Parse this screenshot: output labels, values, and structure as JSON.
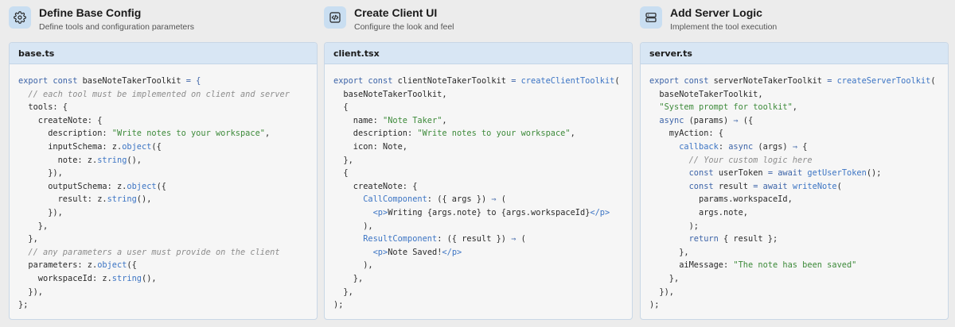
{
  "columns": [
    {
      "title": "Define Base Config",
      "subtitle": "Define tools and configuration parameters",
      "icon": "gear-icon",
      "file_name": "base.ts",
      "code": [
        [
          [
            "kw",
            "export const "
          ],
          [
            "plain",
            "baseNoteTakerToolkit "
          ],
          [
            "kw",
            "= {"
          ]
        ],
        [
          [
            "cmt",
            "  // each tool must be implemented on client and server"
          ]
        ],
        [
          [
            "plain",
            "  tools: {"
          ]
        ],
        [
          [
            "plain",
            "    createNote: {"
          ]
        ],
        [
          [
            "plain",
            "      description: "
          ],
          [
            "str",
            "\"Write notes to your workspace\""
          ],
          [
            "plain",
            ","
          ]
        ],
        [
          [
            "plain",
            "      inputSchema: z."
          ],
          [
            "fn",
            "object"
          ],
          [
            "plain",
            "({"
          ]
        ],
        [
          [
            "plain",
            "        note: z."
          ],
          [
            "fn",
            "string"
          ],
          [
            "plain",
            "(),"
          ]
        ],
        [
          [
            "plain",
            "      }),"
          ]
        ],
        [
          [
            "plain",
            "      outputSchema: z."
          ],
          [
            "fn",
            "object"
          ],
          [
            "plain",
            "({"
          ]
        ],
        [
          [
            "plain",
            "        result: z."
          ],
          [
            "fn",
            "string"
          ],
          [
            "plain",
            "(),"
          ]
        ],
        [
          [
            "plain",
            "      }),"
          ]
        ],
        [
          [
            "plain",
            "    },"
          ]
        ],
        [
          [
            "plain",
            "  },"
          ]
        ],
        [
          [
            "cmt",
            "  // any parameters a user must provide on the client"
          ]
        ],
        [
          [
            "plain",
            "  parameters: z."
          ],
          [
            "fn",
            "object"
          ],
          [
            "plain",
            "({"
          ]
        ],
        [
          [
            "plain",
            "    workspaceId: z."
          ],
          [
            "fn",
            "string"
          ],
          [
            "plain",
            "(),"
          ]
        ],
        [
          [
            "plain",
            "  }),"
          ]
        ],
        [
          [
            "plain",
            "};"
          ]
        ]
      ]
    },
    {
      "title": "Create Client UI",
      "subtitle": "Configure the look and feel",
      "icon": "code-icon",
      "file_name": "client.tsx",
      "code": [
        [
          [
            "kw",
            "export const "
          ],
          [
            "plain",
            "clientNoteTakerToolkit "
          ],
          [
            "kw",
            "= "
          ],
          [
            "fn",
            "createClientToolkit"
          ],
          [
            "plain",
            "("
          ]
        ],
        [
          [
            "plain",
            "  baseNoteTakerToolkit,"
          ]
        ],
        [
          [
            "plain",
            "  {"
          ]
        ],
        [
          [
            "plain",
            "    name: "
          ],
          [
            "str",
            "\"Note Taker\""
          ],
          [
            "plain",
            ","
          ]
        ],
        [
          [
            "plain",
            "    description: "
          ],
          [
            "str",
            "\"Write notes to your workspace\""
          ],
          [
            "plain",
            ","
          ]
        ],
        [
          [
            "plain",
            "    icon: Note,"
          ]
        ],
        [
          [
            "plain",
            "  },"
          ]
        ],
        [
          [
            "plain",
            "  {"
          ]
        ],
        [
          [
            "plain",
            "    createNote: {"
          ]
        ],
        [
          [
            "plain",
            "      "
          ],
          [
            "fn",
            "CallComponent"
          ],
          [
            "plain",
            ": ({ args }) "
          ],
          [
            "kw",
            "⇒"
          ],
          [
            "plain",
            " ("
          ]
        ],
        [
          [
            "plain",
            "        "
          ],
          [
            "tag",
            "<p>"
          ],
          [
            "plain",
            "Writing {args.note} to {args.workspaceId}"
          ],
          [
            "tag",
            "</p>"
          ]
        ],
        [
          [
            "plain",
            "      ),"
          ]
        ],
        [
          [
            "plain",
            "      "
          ],
          [
            "fn",
            "ResultComponent"
          ],
          [
            "plain",
            ": ({ result }) "
          ],
          [
            "kw",
            "⇒"
          ],
          [
            "plain",
            " ("
          ]
        ],
        [
          [
            "plain",
            "        "
          ],
          [
            "tag",
            "<p>"
          ],
          [
            "plain",
            "Note Saved!"
          ],
          [
            "tag",
            "</p>"
          ]
        ],
        [
          [
            "plain",
            "      ),"
          ]
        ],
        [
          [
            "plain",
            "    },"
          ]
        ],
        [
          [
            "plain",
            "  },"
          ]
        ],
        [
          [
            "plain",
            ");"
          ]
        ]
      ]
    },
    {
      "title": "Add Server Logic",
      "subtitle": "Implement the tool execution",
      "icon": "server-icon",
      "file_name": "server.ts",
      "code": [
        [
          [
            "kw",
            "export const "
          ],
          [
            "plain",
            "serverNoteTakerToolkit "
          ],
          [
            "kw",
            "= "
          ],
          [
            "fn",
            "createServerToolkit"
          ],
          [
            "plain",
            "("
          ]
        ],
        [
          [
            "plain",
            "  baseNoteTakerToolkit,"
          ]
        ],
        [
          [
            "plain",
            "  "
          ],
          [
            "str",
            "\"System prompt for toolkit\""
          ],
          [
            "plain",
            ","
          ]
        ],
        [
          [
            "plain",
            "  "
          ],
          [
            "kw",
            "async"
          ],
          [
            "plain",
            " (params) "
          ],
          [
            "kw",
            "⇒"
          ],
          [
            "plain",
            " ({"
          ]
        ],
        [
          [
            "plain",
            "    myAction: {"
          ]
        ],
        [
          [
            "plain",
            "      "
          ],
          [
            "fn",
            "callback"
          ],
          [
            "plain",
            ": "
          ],
          [
            "kw",
            "async"
          ],
          [
            "plain",
            " (args) "
          ],
          [
            "kw",
            "⇒"
          ],
          [
            "plain",
            " {"
          ]
        ],
        [
          [
            "cmt",
            "        // Your custom logic here"
          ]
        ],
        [
          [
            "plain",
            "        "
          ],
          [
            "kw",
            "const "
          ],
          [
            "plain",
            "userToken "
          ],
          [
            "kw",
            "= await "
          ],
          [
            "fn",
            "getUserToken"
          ],
          [
            "plain",
            "();"
          ]
        ],
        [
          [
            "plain",
            "        "
          ],
          [
            "kw",
            "const "
          ],
          [
            "plain",
            "result "
          ],
          [
            "kw",
            "= await "
          ],
          [
            "fn",
            "writeNote"
          ],
          [
            "plain",
            "("
          ]
        ],
        [
          [
            "plain",
            "          params.workspaceId,"
          ]
        ],
        [
          [
            "plain",
            "          args.note,"
          ]
        ],
        [
          [
            "plain",
            "        );"
          ]
        ],
        [
          [
            "plain",
            "        "
          ],
          [
            "kw",
            "return"
          ],
          [
            "plain",
            " { result };"
          ]
        ],
        [
          [
            "plain",
            "      },"
          ]
        ],
        [
          [
            "plain",
            "      aiMessage: "
          ],
          [
            "str",
            "\"The note has been saved\""
          ]
        ],
        [
          [
            "plain",
            "    },"
          ]
        ],
        [
          [
            "plain",
            "  }),"
          ]
        ],
        [
          [
            "plain",
            ");"
          ]
        ]
      ]
    }
  ]
}
